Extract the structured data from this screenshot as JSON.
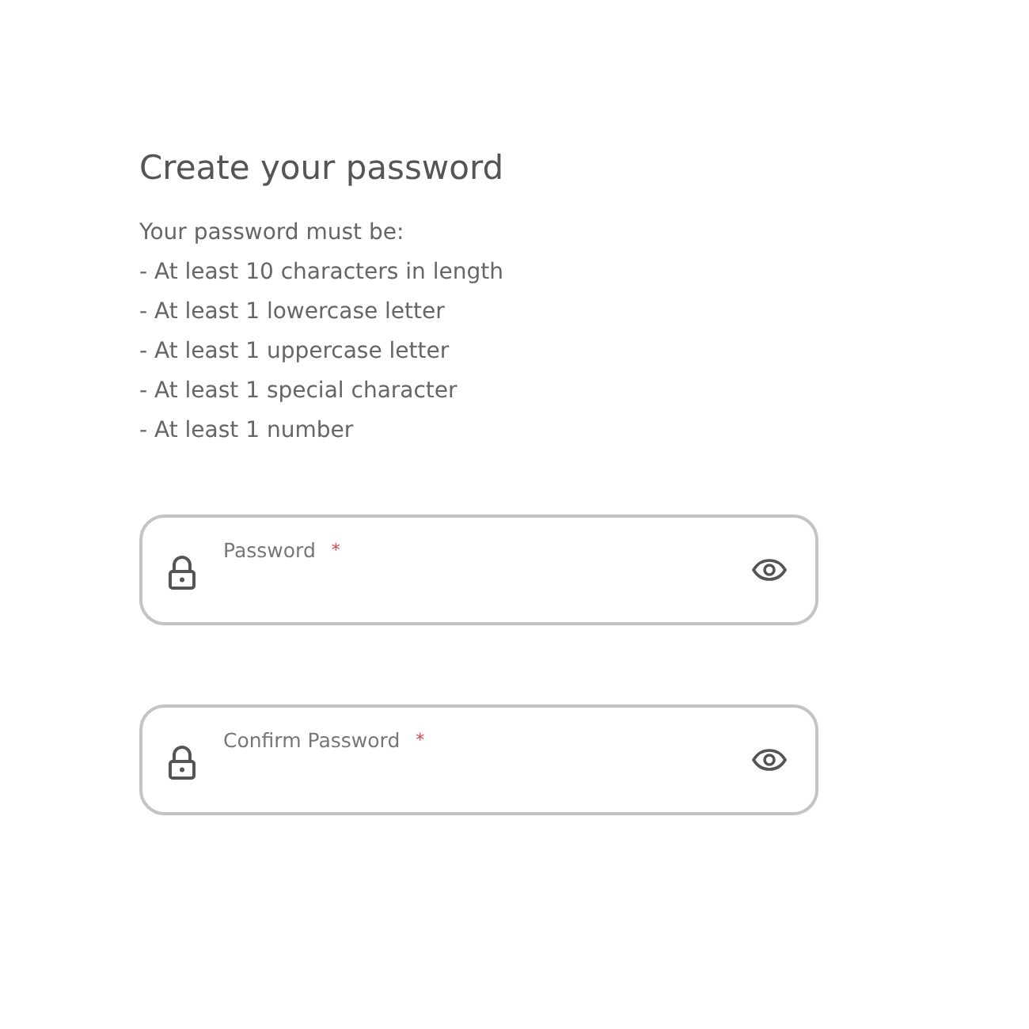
{
  "title": "Create your password",
  "intro": "Your password must be:",
  "rules": [
    "- At least 10 characters in length",
    "- At least 1 lowercase letter",
    "- At least 1 uppercase letter",
    "- At least 1 special character",
    "- At least 1 number"
  ],
  "fields": [
    {
      "label": "Password",
      "required_mark": "*"
    },
    {
      "label": "Confirm Password",
      "required_mark": "*"
    }
  ]
}
